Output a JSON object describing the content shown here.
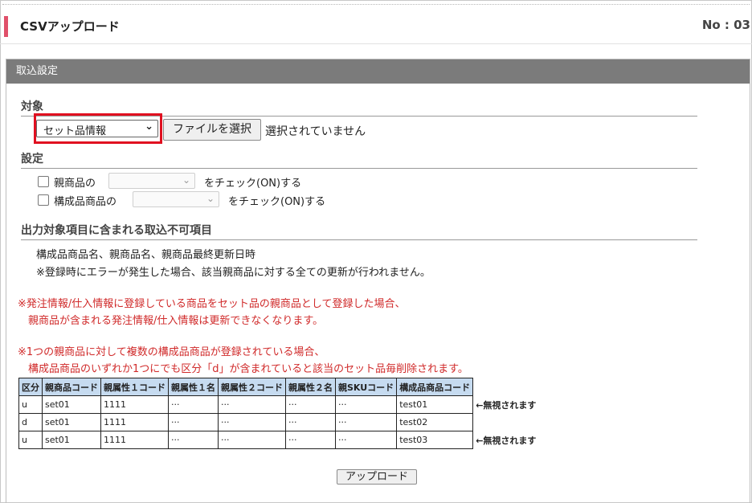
{
  "header": {
    "title": "CSVアップロード",
    "no": "No : 03"
  },
  "panel": {
    "title": "取込設定"
  },
  "target": {
    "heading": "対象",
    "select_value": "セット品情報",
    "file_button": "ファイルを選択",
    "file_status": "選択されていません"
  },
  "settings": {
    "heading": "設定",
    "row1": {
      "prefix": "親商品の",
      "suffix": "をチェック(ON)する"
    },
    "row2": {
      "prefix": "構成品商品の",
      "suffix": "をチェック(ON)する"
    }
  },
  "output": {
    "heading": "出力対象項目に含まれる取込不可項目",
    "line1": "構成品商品名、親商品名、親商品最終更新日時",
    "line2": "※登録時にエラーが発生した場合、該当親商品に対する全ての更新が行われません。"
  },
  "notes": {
    "n1a": "※発注情報/仕入情報に登録している商品をセット品の親商品として登録した場合、",
    "n1b": "親商品が含まれる発注情報/仕入情報は更新できなくなります。",
    "n2a": "※1つの親商品に対して複数の構成品商品が登録されている場合、",
    "n2b": "構成品商品のいずれか1つにでも区分「d」が含まれていると該当のセット品毎削除されます。"
  },
  "table": {
    "headers": [
      "区分",
      "親商品コード",
      "親属性１コード",
      "親属性１名",
      "親属性２コード",
      "親属性２名",
      "親SKUコード",
      "構成品商品コード"
    ],
    "rows": [
      [
        "u",
        "set01",
        "1111",
        "···",
        "···",
        "···",
        "···",
        "test01",
        "←無視されます"
      ],
      [
        "d",
        "set01",
        "1111",
        "···",
        "···",
        "···",
        "···",
        "test02",
        ""
      ],
      [
        "u",
        "set01",
        "1111",
        "···",
        "···",
        "···",
        "···",
        "test03",
        "←無視されます"
      ]
    ]
  },
  "upload_button": "アップロード",
  "colors": {
    "accent": "#e0506a",
    "panel_header": "#7b7b7b",
    "warning": "#d02a2a",
    "table_header": "#c6dbf0",
    "highlight": "#e01020"
  }
}
